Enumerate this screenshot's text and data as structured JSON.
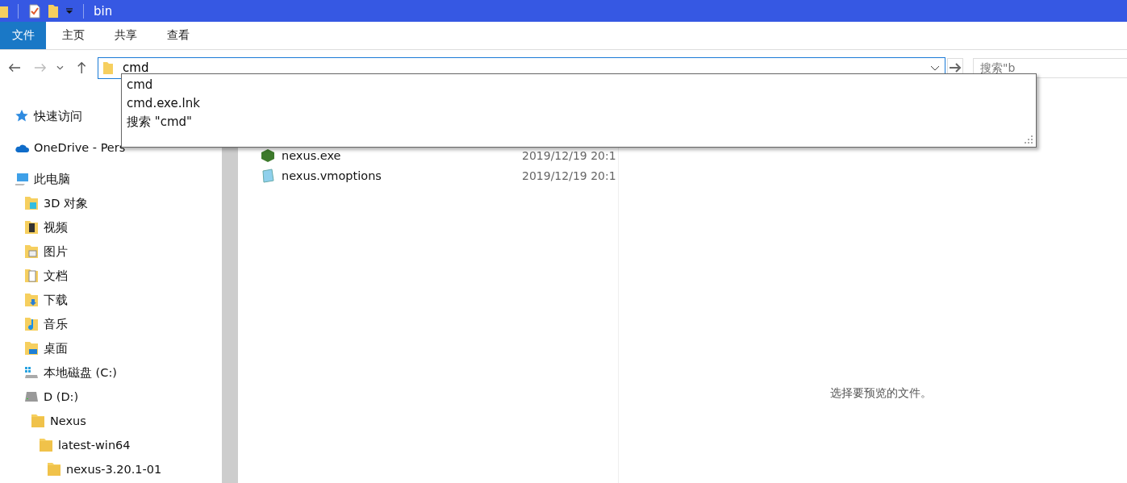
{
  "window": {
    "title": "bin"
  },
  "ribbon_tabs": [
    {
      "label": "文件",
      "selected": true
    },
    {
      "label": "主页",
      "selected": false
    },
    {
      "label": "共享",
      "selected": false
    },
    {
      "label": "查看",
      "selected": false
    }
  ],
  "address_bar": {
    "value": "cmd"
  },
  "search": {
    "placeholder": "搜索\"b"
  },
  "autocomplete": [
    "cmd",
    "cmd.exe.lnk",
    "搜索 \"cmd\""
  ],
  "sidebar": {
    "items": [
      {
        "label": "快速访问",
        "kind": "star"
      },
      {
        "label": "OneDrive - Pers",
        "kind": "cloud"
      },
      {
        "label": "此电脑",
        "kind": "pc",
        "children": [
          {
            "label": "3D 对象",
            "kind": "objects"
          },
          {
            "label": "视频",
            "kind": "video"
          },
          {
            "label": "图片",
            "kind": "pictures"
          },
          {
            "label": "文档",
            "kind": "documents"
          },
          {
            "label": "下载",
            "kind": "downloads"
          },
          {
            "label": "音乐",
            "kind": "music"
          },
          {
            "label": "桌面",
            "kind": "desktop"
          },
          {
            "label": "本地磁盘 (C:)",
            "kind": "system-drive"
          },
          {
            "label": "D (D:)",
            "kind": "drive",
            "children": [
              {
                "label": "Nexus",
                "kind": "folder",
                "children": [
                  {
                    "label": "latest-win64",
                    "kind": "folder",
                    "children": [
                      {
                        "label": "nexus-3.20.1-01",
                        "kind": "folder"
                      }
                    ]
                  }
                ]
              }
            ]
          }
        ]
      }
    ]
  },
  "files": [
    {
      "name": "nexus.exe",
      "modified": "2019/12/19 20:1",
      "kind": "exe"
    },
    {
      "name": "nexus.vmoptions",
      "modified": "2019/12/19 20:1",
      "kind": "text"
    }
  ],
  "preview": {
    "message": "选择要预览的文件。"
  }
}
